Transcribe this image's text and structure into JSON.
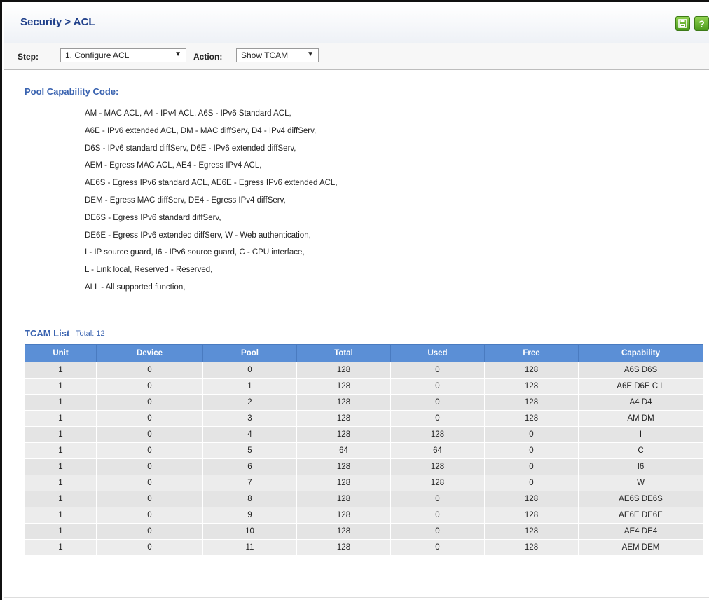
{
  "header": {
    "title": "Security > ACL",
    "save_icon": "save-icon",
    "help_icon": "help-icon",
    "help_glyph": "?"
  },
  "toolbar": {
    "step_label": "Step:",
    "step_value": "1. Configure ACL",
    "action_label": "Action:",
    "action_value": "Show TCAM"
  },
  "pool": {
    "title": "Pool Capability Code:",
    "lines": [
      "AM - MAC ACL, A4 - IPv4 ACL, A6S - IPv6 Standard ACL,",
      "A6E - IPv6 extended ACL, DM - MAC diffServ, D4 - IPv4 diffServ,",
      "D6S - IPv6 standard diffServ, D6E - IPv6 extended diffServ,",
      "AEM - Egress MAC ACL, AE4 - Egress IPv4 ACL,",
      "AE6S - Egress IPv6 standard ACL, AE6E - Egress IPv6 extended ACL,",
      "DEM - Egress MAC diffServ, DE4 - Egress IPv4 diffServ,",
      "DE6S - Egress IPv6 standard diffServ,",
      "DE6E - Egress IPv6 extended diffServ, W - Web authentication,",
      "I - IP source guard, I6 - IPv6 source guard, C - CPU interface,",
      "L - Link local, Reserved - Reserved,",
      "ALL - All supported function,"
    ]
  },
  "tcam": {
    "title": "TCAM List",
    "total": "Total: 12",
    "columns": [
      "Unit",
      "Device",
      "Pool",
      "Total",
      "Used",
      "Free",
      "Capability"
    ],
    "rows": [
      [
        "1",
        "0",
        "0",
        "128",
        "0",
        "128",
        "A6S D6S"
      ],
      [
        "1",
        "0",
        "1",
        "128",
        "0",
        "128",
        "A6E D6E C L"
      ],
      [
        "1",
        "0",
        "2",
        "128",
        "0",
        "128",
        "A4 D4"
      ],
      [
        "1",
        "0",
        "3",
        "128",
        "0",
        "128",
        "AM DM"
      ],
      [
        "1",
        "0",
        "4",
        "128",
        "128",
        "0",
        "I"
      ],
      [
        "1",
        "0",
        "5",
        "64",
        "64",
        "0",
        "C"
      ],
      [
        "1",
        "0",
        "6",
        "128",
        "128",
        "0",
        "I6"
      ],
      [
        "1",
        "0",
        "7",
        "128",
        "128",
        "0",
        "W"
      ],
      [
        "1",
        "0",
        "8",
        "128",
        "0",
        "128",
        "AE6S DE6S"
      ],
      [
        "1",
        "0",
        "9",
        "128",
        "0",
        "128",
        "AE6E DE6E"
      ],
      [
        "1",
        "0",
        "10",
        "128",
        "0",
        "128",
        "AE4 DE4"
      ],
      [
        "1",
        "0",
        "11",
        "128",
        "0",
        "128",
        "AEM DEM"
      ]
    ]
  }
}
